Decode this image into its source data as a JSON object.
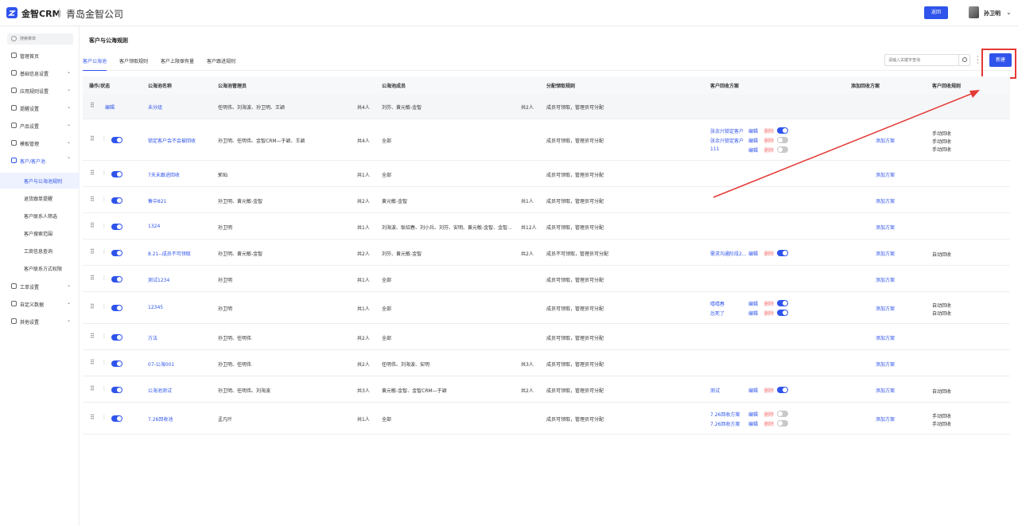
{
  "header": {
    "brand": "金智CRM",
    "company": "青岛金智公司",
    "back_label": "返回",
    "user_name": "孙卫明"
  },
  "sidebar": {
    "search_placeholder": "搜索菜单",
    "items": [
      {
        "label": "管理首页",
        "icon": "home-icon",
        "chevron": false
      },
      {
        "label": "基础信息设置",
        "icon": "settings-icon",
        "chevron": true
      },
      {
        "label": "应用规则设置",
        "icon": "doc-icon",
        "chevron": true
      },
      {
        "label": "提醒设置",
        "icon": "bell-icon",
        "chevron": true
      },
      {
        "label": "产品设置",
        "icon": "box-icon",
        "chevron": true
      },
      {
        "label": "模板管理",
        "icon": "template-icon",
        "chevron": true
      },
      {
        "label": "客户/客户池",
        "icon": "user-icon",
        "chevron": true,
        "expanded": true
      }
    ],
    "sub_items": [
      {
        "label": "客户与公海池规则",
        "active": true
      },
      {
        "label": "退货跟单提醒",
        "active": false
      },
      {
        "label": "客户联系人筛选",
        "active": false
      },
      {
        "label": "客户搜索范围",
        "active": false
      },
      {
        "label": "工商信息查询",
        "active": false
      },
      {
        "label": "客户联系方式权限",
        "active": false
      }
    ],
    "bottom_items": [
      {
        "label": "工单设置",
        "icon": "ticket-icon"
      },
      {
        "label": "自定义数据",
        "icon": "custom-icon"
      },
      {
        "label": "其他设置",
        "icon": "grid-icon"
      }
    ]
  },
  "main": {
    "title": "客户与公海规则",
    "tabs": [
      "客户公海池",
      "客户领取规则",
      "客户上限保有量",
      "客户跟进规则"
    ],
    "active_tab": 0,
    "search_placeholder": "请输入关键字查询",
    "new_label": "新建"
  },
  "table": {
    "headers": [
      "操作/状态",
      "公海池名称",
      "公海池管理员",
      "公海池成员",
      "分配领取规则",
      "客户回收方案",
      "添加回收方案",
      "客户回收规则"
    ],
    "edit_label": "编辑",
    "delete_label": "删除",
    "add_plan_label": "添加方案",
    "rows": [
      {
        "first": true,
        "op": "编辑",
        "name": "未分组",
        "admins": "任明伟、刘海波、孙卫明、王颖",
        "admin_count": "共4人",
        "members": "刘芬、黄元敏-金智",
        "member_count": "共2人",
        "rule": "成员可领取，管理员可分配",
        "plans": [],
        "add_plan": false,
        "recycle": []
      },
      {
        "toggle": true,
        "name": "锁定客户会不会被回收",
        "admins": "孙卫明、任明伟、金智CRM—于颖、王颖",
        "admin_count": "共4人",
        "members": "全部",
        "member_count": "",
        "rule": "成员可领取，管理员可分配",
        "plans": [
          {
            "name": "张余兴锁定客户",
            "on": true
          },
          {
            "name": "张余兴锁定客户",
            "on": false
          },
          {
            "name": "111",
            "on": false
          }
        ],
        "add_plan": true,
        "recycle": [
          "手动回收",
          "手动回收",
          "手动回收"
        ]
      },
      {
        "toggle": true,
        "name": "7天未跟进回收",
        "admins": "郭灿",
        "admin_count": "共1人",
        "members": "全部",
        "member_count": "",
        "rule": "成员可领取，管理员可分配",
        "plans": [],
        "add_plan": true,
        "recycle": []
      },
      {
        "toggle": true,
        "name": "售中821",
        "admins": "孙卫明、黄元敏-金智",
        "admin_count": "共2人",
        "members": "黄元敏-金智",
        "member_count": "共1人",
        "rule": "成员可领取，管理员可分配",
        "plans": [],
        "add_plan": true,
        "recycle": []
      },
      {
        "toggle": true,
        "name": "1324",
        "admins": "孙卫明",
        "admin_count": "共1人",
        "members": "刘海波、耿绍春、刘小兵、刘芬、安明、黄元敏-金智、金智...",
        "member_count": "共12人",
        "rule": "成员可领取，管理员可分配",
        "plans": [],
        "add_plan": true,
        "recycle": []
      },
      {
        "toggle": true,
        "name": "8.21--成员不可领取",
        "admins": "孙卫明、黄元敏-金智",
        "admin_count": "共2人",
        "members": "刘芬、黄元敏-金智",
        "member_count": "共2人",
        "rule": "成员不可领取，管理员可分配",
        "plans": [
          {
            "name": "需求沟通阶段2...",
            "on": true
          }
        ],
        "add_plan": true,
        "recycle": [
          "自动回收"
        ]
      },
      {
        "toggle": true,
        "name": "测试1234",
        "admins": "孙卫明",
        "admin_count": "共1人",
        "members": "全部",
        "member_count": "",
        "rule": "成员可领取，管理员可分配",
        "plans": [],
        "add_plan": true,
        "recycle": []
      },
      {
        "toggle": true,
        "name": "12345",
        "admins": "孙卫明",
        "admin_count": "共1人",
        "members": "全部",
        "member_count": "",
        "rule": "成员可领取，管理员可分配",
        "plans": [
          {
            "name": "嘻嘻春",
            "on": true
          },
          {
            "name": "怂死了",
            "on": true
          }
        ],
        "add_plan": true,
        "recycle": [
          "自动回收",
          "自动回收"
        ]
      },
      {
        "toggle": true,
        "name": "方法",
        "admins": "孙卫明、任明伟",
        "admin_count": "共2人",
        "members": "全部",
        "member_count": "",
        "rule": "成员可领取，管理员可分配",
        "plans": [],
        "add_plan": true,
        "recycle": []
      },
      {
        "toggle": true,
        "name": "07-公海001",
        "admins": "孙卫明、任明伟",
        "admin_count": "共2人",
        "members": "任明伟、刘海波、安明",
        "member_count": "共3人",
        "rule": "成员可领取，管理员可分配",
        "plans": [],
        "add_plan": true,
        "recycle": []
      },
      {
        "toggle": true,
        "name": "公海池测试",
        "admins": "孙卫明、任明伟、刘海波",
        "admin_count": "共3人",
        "members": "黄元敏-金智、金智CRM—于颖",
        "member_count": "共2人",
        "rule": "成员可领取，管理员可分配",
        "plans": [
          {
            "name": "测试",
            "on": true
          }
        ],
        "add_plan": true,
        "recycle": [
          "自动回收"
        ]
      },
      {
        "toggle": true,
        "name": "7.26回收池",
        "admins": "孟凡叶",
        "admin_count": "共1人",
        "members": "全部",
        "member_count": "",
        "rule": "成员可领取，管理员可分配",
        "plans": [
          {
            "name": "7.26回收方案",
            "on": false
          },
          {
            "name": "7.26回收方案",
            "on": false
          }
        ],
        "add_plan": true,
        "recycle": [
          "手动回收",
          "手动回收"
        ]
      }
    ]
  },
  "colors": {
    "accent": "#2f54eb",
    "annotation": "#e53935",
    "delete": "#f56c6c"
  }
}
